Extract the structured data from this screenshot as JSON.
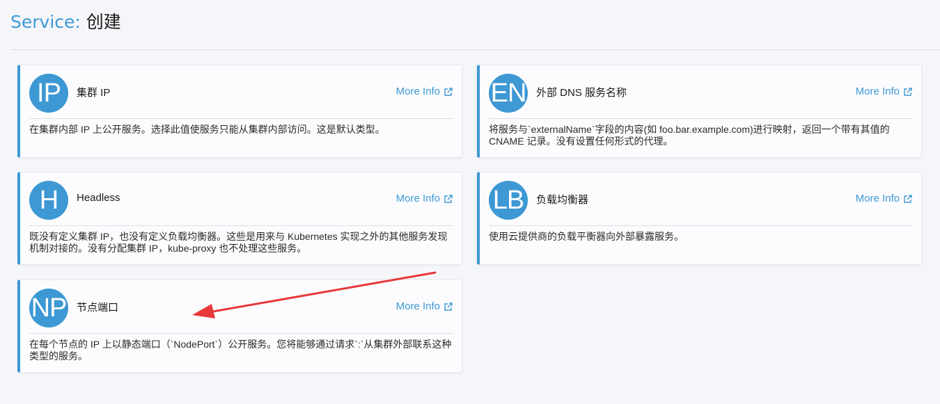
{
  "header": {
    "type_label": "Service:",
    "action_label": "创建"
  },
  "more_info_label": "More Info",
  "accent_color": "#3d98d3",
  "annotation_color": "#e8383a",
  "cards": [
    {
      "abbr": "IP",
      "title": "集群 IP",
      "description": "在集群内部 IP 上公开服务。选择此值使服务只能从集群内部访问。这是默认类型。"
    },
    {
      "abbr": "EN",
      "title": "外部 DNS 服务名称",
      "description": "将服务与`externalName`字段的内容(如 foo.bar.example.com)进行映射，返回一个带有其值的 CNAME 记录。没有设置任何形式的代理。"
    },
    {
      "abbr": "H",
      "title": "Headless",
      "description": "既没有定义集群 IP，也没有定义负载均衡器。这些是用来与 Kubernetes 实现之外的其他服务发现机制对接的。没有分配集群 IP，kube-proxy 也不处理这些服务。"
    },
    {
      "abbr": "LB",
      "title": "负载均衡器",
      "description": "使用云提供商的负载平衡器向外部暴露服务。"
    },
    {
      "abbr": "NP",
      "title": "节点端口",
      "description": "在每个节点的 IP 上以静态端口（`NodePort`）公开服务。您将能够通过请求`:`从集群外部联系这种类型的服务。"
    }
  ]
}
